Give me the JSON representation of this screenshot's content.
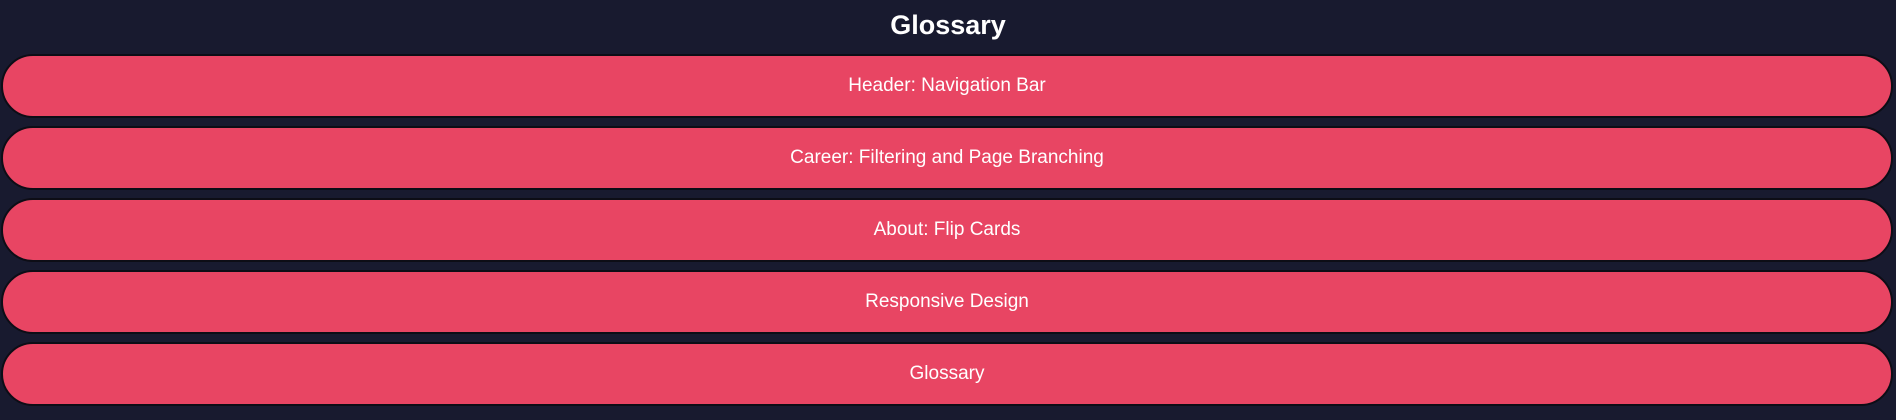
{
  "page": {
    "title": "Glossary"
  },
  "nav": {
    "items": [
      {
        "label": "Header: Navigation Bar"
      },
      {
        "label": "Career: Filtering and Page Branching"
      },
      {
        "label": "About: Flip Cards"
      },
      {
        "label": "Responsive Design"
      },
      {
        "label": "Glossary"
      }
    ]
  },
  "colors": {
    "background": "#181a2f",
    "pill": "#e84563",
    "text": "#ffffff",
    "border": "#0d0d16"
  }
}
